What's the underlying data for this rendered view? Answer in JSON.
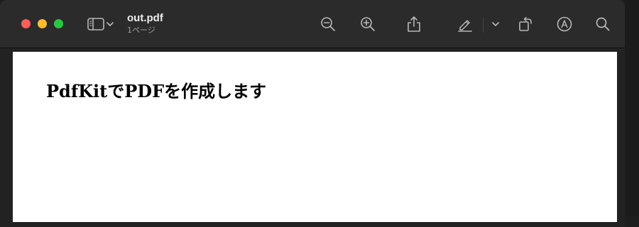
{
  "window": {
    "title": "out.pdf",
    "subtitle": "1ページ"
  },
  "toolbar": {
    "icons": [
      "sidebar-toggle-icon",
      "chevron-down-icon",
      "zoom-out-icon",
      "zoom-in-icon",
      "share-icon",
      "markup-pen-icon",
      "rotate-icon",
      "annotate-circle-icon",
      "search-icon"
    ]
  },
  "document": {
    "heading": "PdfKitでPDFを作成します"
  },
  "colors": {
    "close": "#ff5f57",
    "minimize": "#febc2e",
    "maximize": "#28c840",
    "toolbar_bg": "#2b2b2b",
    "page_bg": "#ffffff"
  }
}
